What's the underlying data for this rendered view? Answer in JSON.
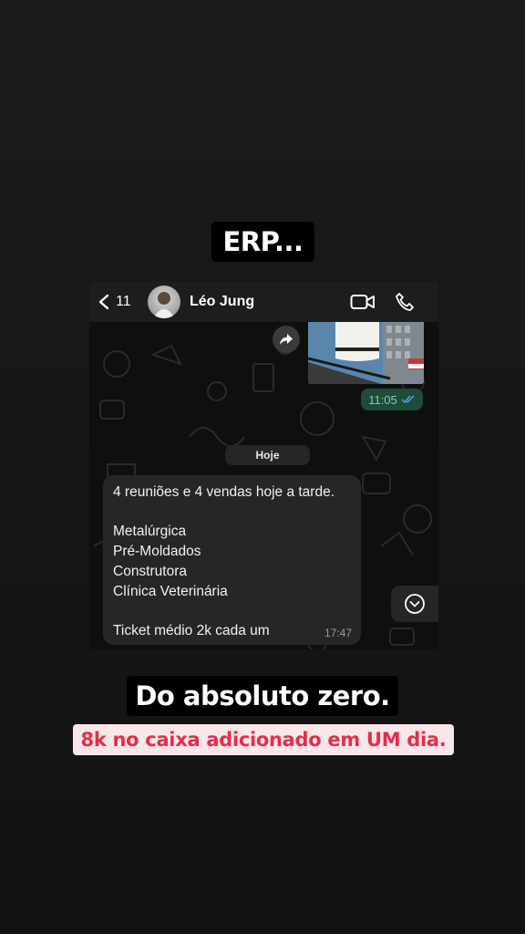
{
  "story": {
    "caption_top": "ERP...",
    "caption_middle": "Do absoluto zero.",
    "caption_bottom": "8k no caixa adicionado em UM dia.",
    "caption_bottom_color": "#e42e4a"
  },
  "chat": {
    "back_count": "11",
    "contact_name": "Léo Jung",
    "icons": [
      "chevron-left-icon",
      "video-call-icon",
      "phone-icon",
      "forward-icon",
      "double-check-icon",
      "chevron-down-icon"
    ],
    "sent_time": "11:05",
    "date_divider": "Hoje",
    "message": {
      "text": "4 reuniões e 4 vendas hoje a tarde.\n\nMetalúrgica\nPré-Moldados\nConstrutora\nClínica Veterinária\n\nTicket médio 2k cada um",
      "time": "17:47"
    }
  }
}
